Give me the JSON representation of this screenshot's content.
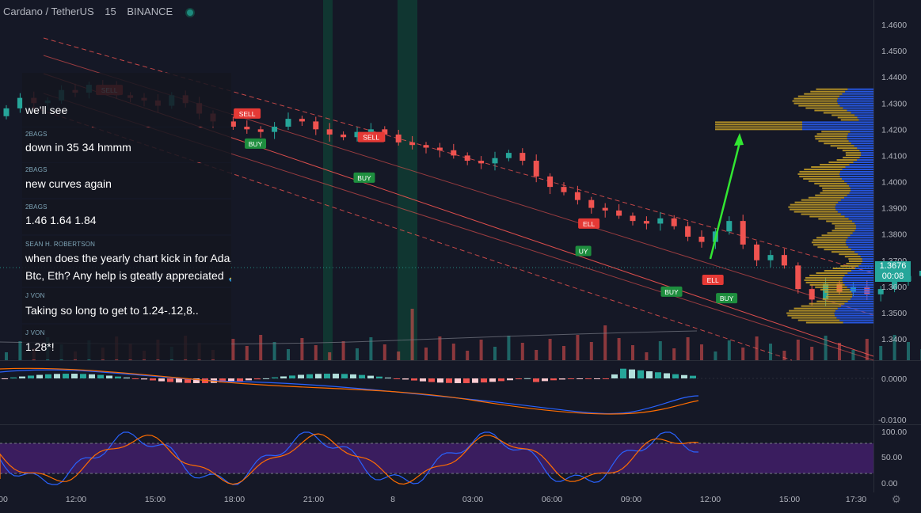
{
  "header": {
    "symbol": "Cardano / TetherUS",
    "interval": "15",
    "exchange": "BINANCE",
    "status_color": "#1d8a7e"
  },
  "chat": {
    "messages": [
      {
        "user": "",
        "text": "we'll see"
      },
      {
        "user": "2BAGS",
        "text": "down in 35 34 hmmm"
      },
      {
        "user": "2BAGS",
        "text": "new curves again"
      },
      {
        "user": "2BAGS",
        "text": "1.46 1.64 1.84"
      },
      {
        "user": "SEAN H. ROBERTSON",
        "text": "when does the yearly chart kick in for Ada,",
        "text2": "Btc, Eth? Any help is gteatly appreciated 🙏😊"
      },
      {
        "user": "J VON",
        "text": "Taking so long to get to 1.24-.12,8.."
      },
      {
        "user": "J VON",
        "text": "1.28*!"
      }
    ]
  },
  "price_axis": {
    "labels": [
      "1.4600",
      "1.4500",
      "1.4400",
      "1.4300",
      "1.4200",
      "1.4100",
      "1.4000",
      "1.3900",
      "1.3800",
      "1.3700",
      "1.3600",
      "1.3500",
      "1.3400"
    ],
    "current_price": "1.3676",
    "countdown": "00:08",
    "tag_color": "#26a69a"
  },
  "macd_axis": {
    "labels": [
      "0.0000",
      "-0.0100"
    ]
  },
  "stoch_axis": {
    "labels": [
      "100.00",
      "50.00",
      "0.00"
    ]
  },
  "time_axis": {
    "labels": [
      "00",
      "12:00",
      "15:00",
      "18:00",
      "21:00",
      "8",
      "03:00",
      "06:00",
      "09:00",
      "12:00",
      "15:00",
      "17:30"
    ]
  },
  "signals": [
    {
      "type": "sell",
      "text": "SELL",
      "x": 6.5,
      "price": 1.437
    },
    {
      "type": "sell",
      "text": "SELL",
      "x": 16.5,
      "price": 1.428
    },
    {
      "type": "buy",
      "text": "BUY",
      "x": 17.3,
      "price": 1.4165
    },
    {
      "type": "sell",
      "text": "SELL",
      "x": 25.5,
      "price": 1.419
    },
    {
      "type": "buy",
      "text": "BUY",
      "x": 25.2,
      "price": 1.4035
    },
    {
      "type": "sell",
      "text": "ELL",
      "x": 41.5,
      "price": 1.386
    },
    {
      "type": "buy",
      "text": "UY",
      "x": 41.3,
      "price": 1.3755
    },
    {
      "type": "buy",
      "text": "BUY",
      "x": 47.5,
      "price": 1.36
    },
    {
      "type": "sell",
      "text": "ELL",
      "x": 50.5,
      "price": 1.3645
    },
    {
      "type": "buy",
      "text": "BUY",
      "x": 51.5,
      "price": 1.3575
    }
  ],
  "colors": {
    "up": "#26a69a",
    "down": "#ef5350",
    "sell_badge": "#e53935",
    "buy_badge": "#1e8e3e",
    "arrow": "#32e632",
    "volume_profile_up": "#2962ff",
    "volume_profile_down": "#c9a227",
    "stoch_k": "#2962ff",
    "stoch_d": "#ff6d00",
    "stoch_band": "#4a1f78"
  }
}
